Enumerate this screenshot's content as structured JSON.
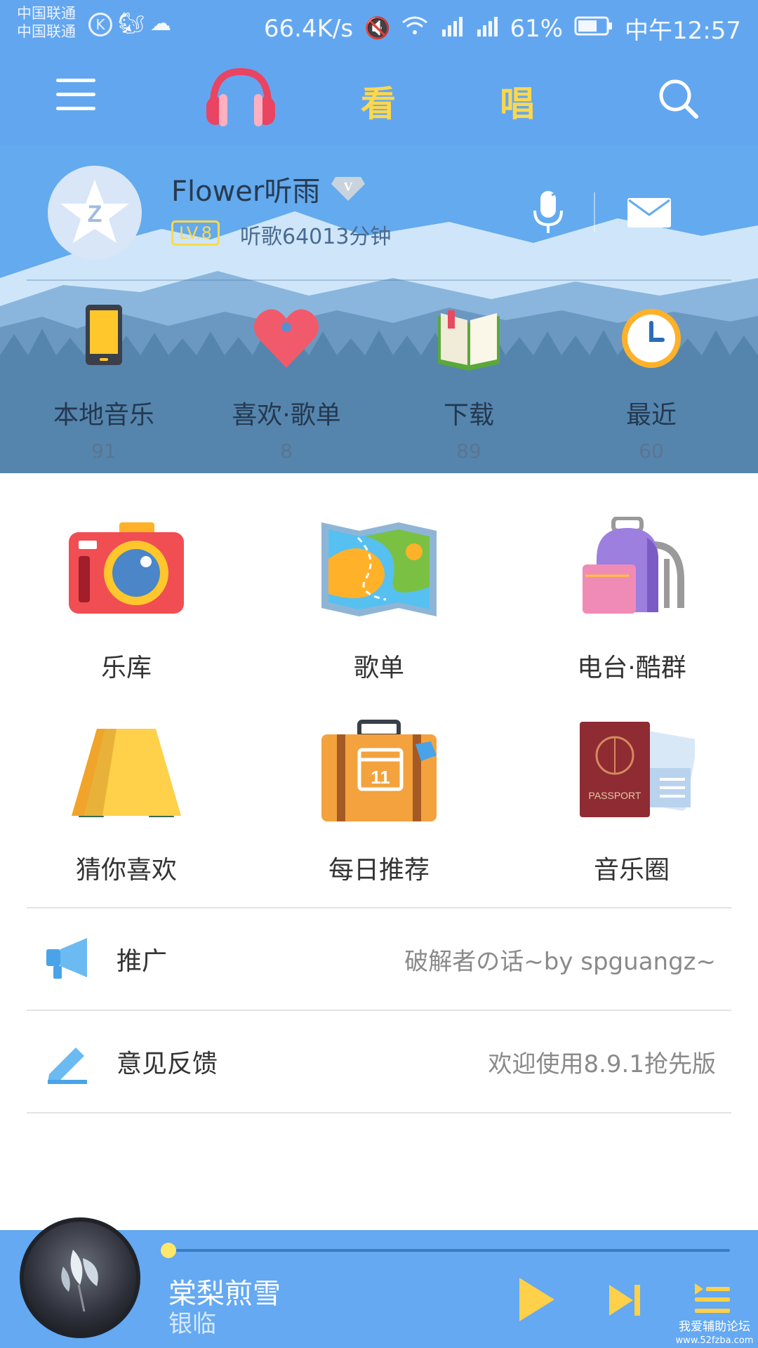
{
  "status_bar": {
    "carrier_1": "中国联通",
    "carrier_2": "中国联通",
    "net_speed": "66.4K/s",
    "battery": "61%",
    "time": "中午12:57"
  },
  "nav": {
    "tab_watch": "看",
    "tab_sing": "唱"
  },
  "profile": {
    "username": "Flower听雨",
    "level": "LV.8",
    "listen_time": "听歌64013分钟"
  },
  "shortcuts": [
    {
      "label": "本地音乐",
      "count": "91",
      "icon": "phone-icon"
    },
    {
      "label": "喜欢·歌单",
      "count": "8",
      "icon": "heart-icon"
    },
    {
      "label": "下载",
      "count": "89",
      "icon": "book-icon"
    },
    {
      "label": "最近",
      "count": "60",
      "icon": "clock-icon"
    }
  ],
  "grid": [
    {
      "label": "乐库",
      "icon": "camera-icon"
    },
    {
      "label": "歌单",
      "icon": "map-icon"
    },
    {
      "label": "电台·酷群",
      "icon": "backpack-icon"
    },
    {
      "label": "猜你喜欢",
      "icon": "tent-icon"
    },
    {
      "label": "每日推荐",
      "icon": "suitcase-icon"
    },
    {
      "label": "音乐圈",
      "icon": "passport-icon"
    }
  ],
  "suitcase_day": "11",
  "passport_text": "PASSPORT",
  "list": [
    {
      "label": "推广",
      "value": "破解者の话~by spguangz~",
      "icon": "megaphone-icon"
    },
    {
      "label": "意见反馈",
      "value": "欢迎使用8.9.1抢先版",
      "icon": "pencil-icon"
    }
  ],
  "player": {
    "title": "棠梨煎雪",
    "artist": "银临",
    "progress": 0.0
  },
  "watermark": {
    "line1": "我爱辅助论坛",
    "line2": "www.52fzba.com"
  },
  "colors": {
    "header_blue": "#63a6f0",
    "accent_yellow": "#ffd84a",
    "player_blue": "#64a9f1"
  }
}
